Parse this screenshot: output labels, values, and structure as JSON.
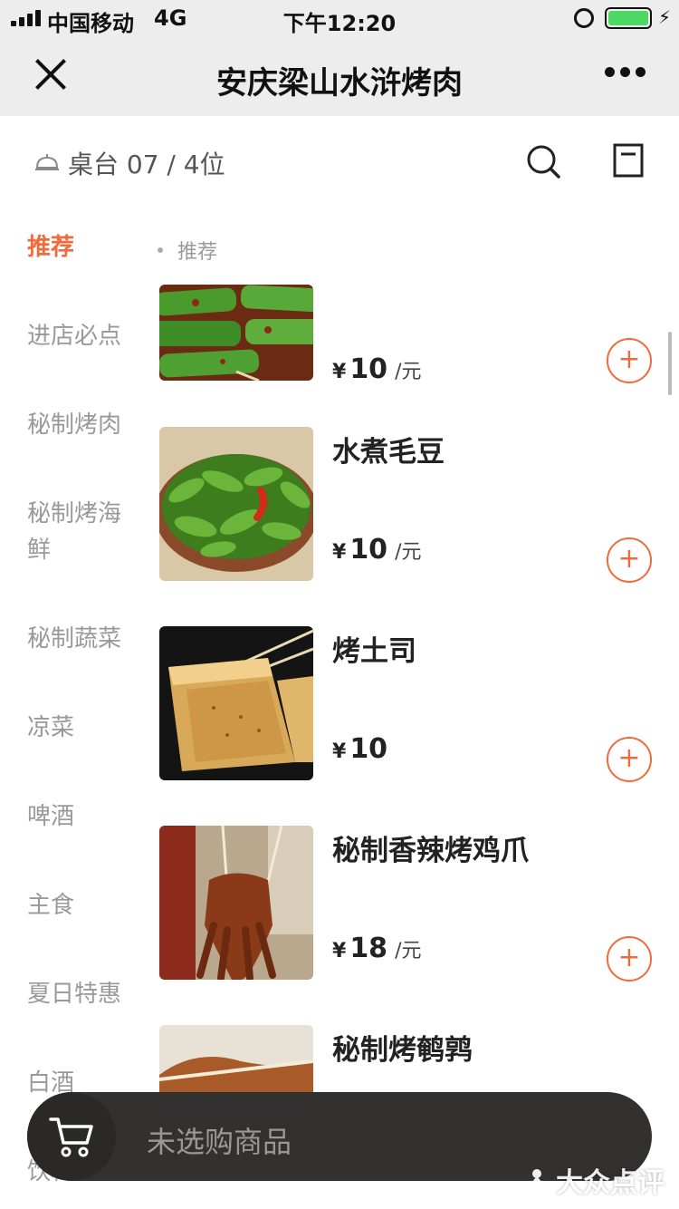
{
  "status": {
    "carrier": "中国移动",
    "network": "4G",
    "time": "下午12:20"
  },
  "nav": {
    "title": "安庆梁山水浒烤肉"
  },
  "table": {
    "label": "桌台 07 / 4位"
  },
  "categories": [
    {
      "label": "推荐",
      "active": true
    },
    {
      "label": "进店必点"
    },
    {
      "label": "秘制烤肉"
    },
    {
      "label": "秘制烤海\n鲜"
    },
    {
      "label": "秘制蔬菜"
    },
    {
      "label": "凉菜"
    },
    {
      "label": "啤酒"
    },
    {
      "label": "主食"
    },
    {
      "label": "夏日特惠"
    },
    {
      "label": "白酒"
    },
    {
      "label": "饮料"
    }
  ],
  "section": {
    "label": "推荐"
  },
  "items": [
    {
      "name": "",
      "currency": "¥",
      "price": "10",
      "unit": "/元",
      "add": "+"
    },
    {
      "name": "水煮毛豆",
      "currency": "¥",
      "price": "10",
      "unit": "/元",
      "add": "+"
    },
    {
      "name": "烤土司",
      "currency": "¥",
      "price": "10",
      "unit": "",
      "add": "+"
    },
    {
      "name": "秘制香辣烤鸡爪",
      "currency": "¥",
      "price": "18",
      "unit": "/元",
      "add": "+"
    },
    {
      "name": "秘制烤鹌鹑",
      "currency": "",
      "price": "",
      "unit": "",
      "add": ""
    }
  ],
  "cart": {
    "empty_text": "未选购商品"
  },
  "watermark": {
    "text": "大众点评"
  },
  "colors": {
    "accent": "#ef6b3e",
    "navbar_bg": "#ededed",
    "cart_bg": "#333030"
  }
}
